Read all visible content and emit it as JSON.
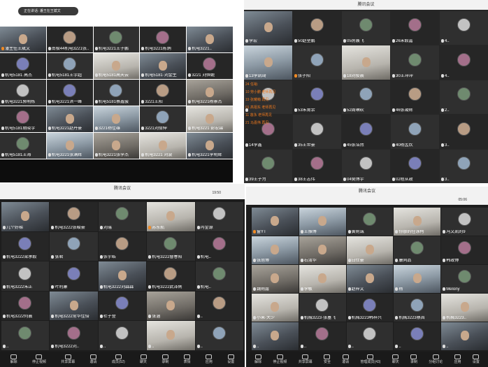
{
  "window_top_left": {
    "banner": "正在讲话: 潘王在王斌文",
    "tiles": [
      {
        "label": "潘主任王斌文",
        "mic": "o",
        "kind": "video"
      },
      {
        "label": "南极44机电3221张..",
        "kind": "avatar"
      },
      {
        "label": "机电3221王子鹏",
        "kind": "avatar"
      },
      {
        "label": "机电3221陈炳",
        "kind": "avatar"
      },
      {
        "label": "机电3221..",
        "kind": "video"
      },
      {
        "label": "机电5181 高杰",
        "kind": "avatar"
      },
      {
        "label": "机电5181王宇超",
        "kind": "avatar"
      },
      {
        "label": "机电5181高天云",
        "kind": "video"
      },
      {
        "label": "机电5181·刘金生",
        "kind": "video"
      },
      {
        "label": "3221 刘恒妮",
        "kind": "avatar"
      },
      {
        "label": "机电3221郭明栋",
        "kind": "avatar"
      },
      {
        "label": "机电3221洪一峰",
        "kind": "avatar"
      },
      {
        "label": "机电5181蔡鑫骏",
        "kind": "avatar"
      },
      {
        "label": "3221王阳",
        "kind": "avatar"
      },
      {
        "label": "机电3221杨景杰",
        "kind": "video"
      },
      {
        "label": "机电5181胡晓宇",
        "kind": "avatar"
      },
      {
        "label": "机电3221赵丹豪",
        "kind": "video"
      },
      {
        "label": "3221杨佳雄",
        "kind": "video"
      },
      {
        "label": "3221刘倩伸",
        "kind": "avatar"
      },
      {
        "label": "机电3221 彭宏霖",
        "kind": "video"
      },
      {
        "label": "机电5181王海",
        "kind": "avatar"
      },
      {
        "label": "机电3221张满辉",
        "kind": "video"
      },
      {
        "label": "机电3221张李杰",
        "kind": "video"
      },
      {
        "label": "机电3221 刘波",
        "kind": "video"
      },
      {
        "label": "机电3221李明辉",
        "kind": "video"
      }
    ]
  },
  "window_top_right": {
    "title": "腾讯会议",
    "tiles": [
      {
        "label": "李宏",
        "kind": "video"
      },
      {
        "label": "50赵堃鹏",
        "kind": "avatar"
      },
      {
        "label": "05房展飞",
        "kind": "avatar"
      },
      {
        "label": "26宋毅嘉",
        "kind": "avatar"
      },
      {
        "label": "4..",
        "kind": "avatar"
      },
      {
        "label": "13李凯琦",
        "kind": "video"
      },
      {
        "label": "张子阳",
        "mic": "o",
        "kind": "avatar"
      },
      {
        "label": "18刘俊晨",
        "kind": "video"
      },
      {
        "label": "30王冲冲",
        "kind": "avatar"
      },
      {
        "label": "4..",
        "kind": "avatar"
      },
      {
        "label": "",
        "kind": "avatar"
      },
      {
        "label": "53朱膏余",
        "kind": "avatar"
      },
      {
        "label": "52周琳砍",
        "kind": "avatar"
      },
      {
        "label": "46张凝辉",
        "kind": "avatar"
      },
      {
        "label": "2..",
        "kind": "avatar"
      },
      {
        "label": "14李鑫",
        "kind": "avatar"
      },
      {
        "label": "35王世豪",
        "kind": "avatar"
      },
      {
        "label": "45张浩然",
        "kind": "avatar"
      },
      {
        "label": "40杨孟炊",
        "kind": "avatar"
      },
      {
        "label": "3..",
        "kind": "avatar"
      },
      {
        "label": "39王子为",
        "kind": "avatar"
      },
      {
        "label": "38王志伟",
        "kind": "avatar"
      },
      {
        "label": "04樊博宇",
        "kind": "avatar"
      },
      {
        "label": "02程从政",
        "kind": "avatar"
      },
      {
        "label": "3..",
        "kind": "avatar"
      }
    ],
    "chat": [
      "24 任裕:",
      "10 劳小鹏 老师再见",
      "19 张耀萌 再见",
      "01 高祖东 老师再见",
      "11 莲永 老师再见",
      "21 马嘉伟 再见"
    ]
  },
  "window_bottom_left": {
    "title": "腾讯会议",
    "time": "19:50",
    "tiles": [
      {
        "label": "几个好梯",
        "kind": "video"
      },
      {
        "label": "机电3222张峻豪",
        "kind": "avatar"
      },
      {
        "label": "刘瑞",
        "kind": "avatar"
      },
      {
        "label": "苏东航",
        "mic": "o",
        "kind": "video"
      },
      {
        "label": "冉金源",
        "kind": "avatar"
      },
      {
        "label": "机电3222梁承毅",
        "kind": "avatar"
      },
      {
        "label": "张君",
        "kind": "avatar"
      },
      {
        "label": "张宇皓",
        "kind": "avatar"
      },
      {
        "label": "机电3222曹春阳",
        "kind": "avatar"
      },
      {
        "label": "机电..",
        "kind": "avatar"
      },
      {
        "label": "机电3222朱正",
        "kind": "avatar"
      },
      {
        "label": "叶利康",
        "kind": "avatar"
      },
      {
        "label": "机电3222刘森森",
        "kind": "video"
      },
      {
        "label": "机电3222武泽俐",
        "kind": "avatar"
      },
      {
        "label": "机电..",
        "kind": "avatar"
      },
      {
        "label": "机电3222何晨",
        "kind": "avatar"
      },
      {
        "label": "机电3222常华佳倍",
        "kind": "video"
      },
      {
        "label": "杜子登",
        "kind": "avatar"
      },
      {
        "label": "张涵",
        "kind": "video"
      },
      {
        "label": "..",
        "kind": "avatar"
      },
      {
        "label": "..",
        "kind": "avatar"
      },
      {
        "label": "机电3222刘..",
        "kind": "avatar"
      },
      {
        "label": "..",
        "kind": "avatar"
      },
      {
        "label": "..",
        "kind": "video"
      },
      {
        "label": "..",
        "kind": "avatar"
      }
    ],
    "toolbar": [
      "解除",
      "停止视频",
      "共享屏幕",
      "邀请",
      "成员(52)",
      "聊天",
      "录制",
      "表情",
      "应用",
      "设置"
    ]
  },
  "window_bottom_right": {
    "title": "腾讯会议",
    "time": "05:06",
    "tiles": [
      {
        "label": "窗YT",
        "mic": "o",
        "kind": "video"
      },
      {
        "label": "王振博",
        "kind": "video"
      },
      {
        "label": "黄则诚",
        "kind": "avatar"
      },
      {
        "label": "你那的任泳柯",
        "kind": "video"
      },
      {
        "label": "冯文凯的9",
        "kind": "avatar"
      },
      {
        "label": "张旭博",
        "kind": "video"
      },
      {
        "label": "石清华",
        "kind": "video"
      },
      {
        "label": "白仕豪",
        "kind": "video"
      },
      {
        "label": "康同品",
        "kind": "avatar"
      },
      {
        "label": "韩政博",
        "kind": "avatar"
      },
      {
        "label": "魏雨露",
        "kind": "video"
      },
      {
        "label": "李敏",
        "kind": "video"
      },
      {
        "label": "赵梓文",
        "kind": "video"
      },
      {
        "label": "杨",
        "kind": "video"
      },
      {
        "label": "Melony",
        "kind": "avatar"
      },
      {
        "label": "小米·大少",
        "kind": "video"
      },
      {
        "label": "机械3223·张塞飞",
        "kind": "avatar"
      },
      {
        "label": "机械3223韩梓兴",
        "kind": "avatar"
      },
      {
        "label": "机械3223蔡昌",
        "kind": "avatar"
      },
      {
        "label": "机械3223..",
        "kind": "video"
      },
      {
        "label": "..",
        "kind": "video"
      },
      {
        "label": "..",
        "kind": "avatar"
      },
      {
        "label": "..",
        "kind": "avatar"
      },
      {
        "label": "..",
        "kind": "avatar"
      },
      {
        "label": "..",
        "kind": "video"
      }
    ],
    "toolbar": [
      "解除",
      "停止视频",
      "共享屏幕",
      "安全",
      "邀请",
      "管理成员(43)",
      "聊天",
      "录制",
      "分组讨论",
      "应用",
      "设置"
    ]
  }
}
